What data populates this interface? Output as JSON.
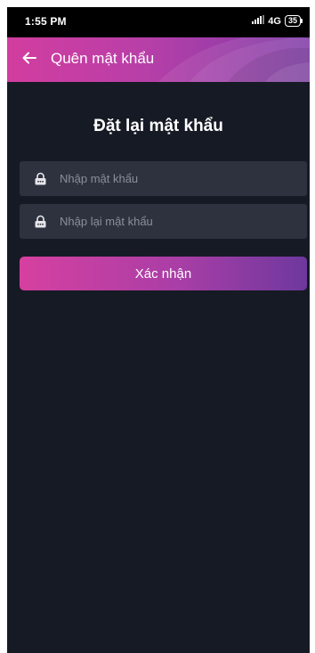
{
  "status_bar": {
    "time": "1:55 PM",
    "network": "4G",
    "battery": "35"
  },
  "app_bar": {
    "title": "Quên mật khẩu",
    "back_icon": "arrow-left-icon"
  },
  "page": {
    "title": "Đặt lại mật khẩu"
  },
  "form": {
    "password": {
      "placeholder": "Nhập mật khẩu",
      "value": "",
      "icon": "lock-icon"
    },
    "confirm_password": {
      "placeholder": "Nhập lại mật khẩu",
      "value": "",
      "icon": "lock-icon"
    },
    "submit_label": "Xác nhận"
  },
  "colors": {
    "background": "#161a24",
    "field_background": "#2e323f",
    "accent_start": "#d640a0",
    "accent_end": "#6e389e"
  }
}
